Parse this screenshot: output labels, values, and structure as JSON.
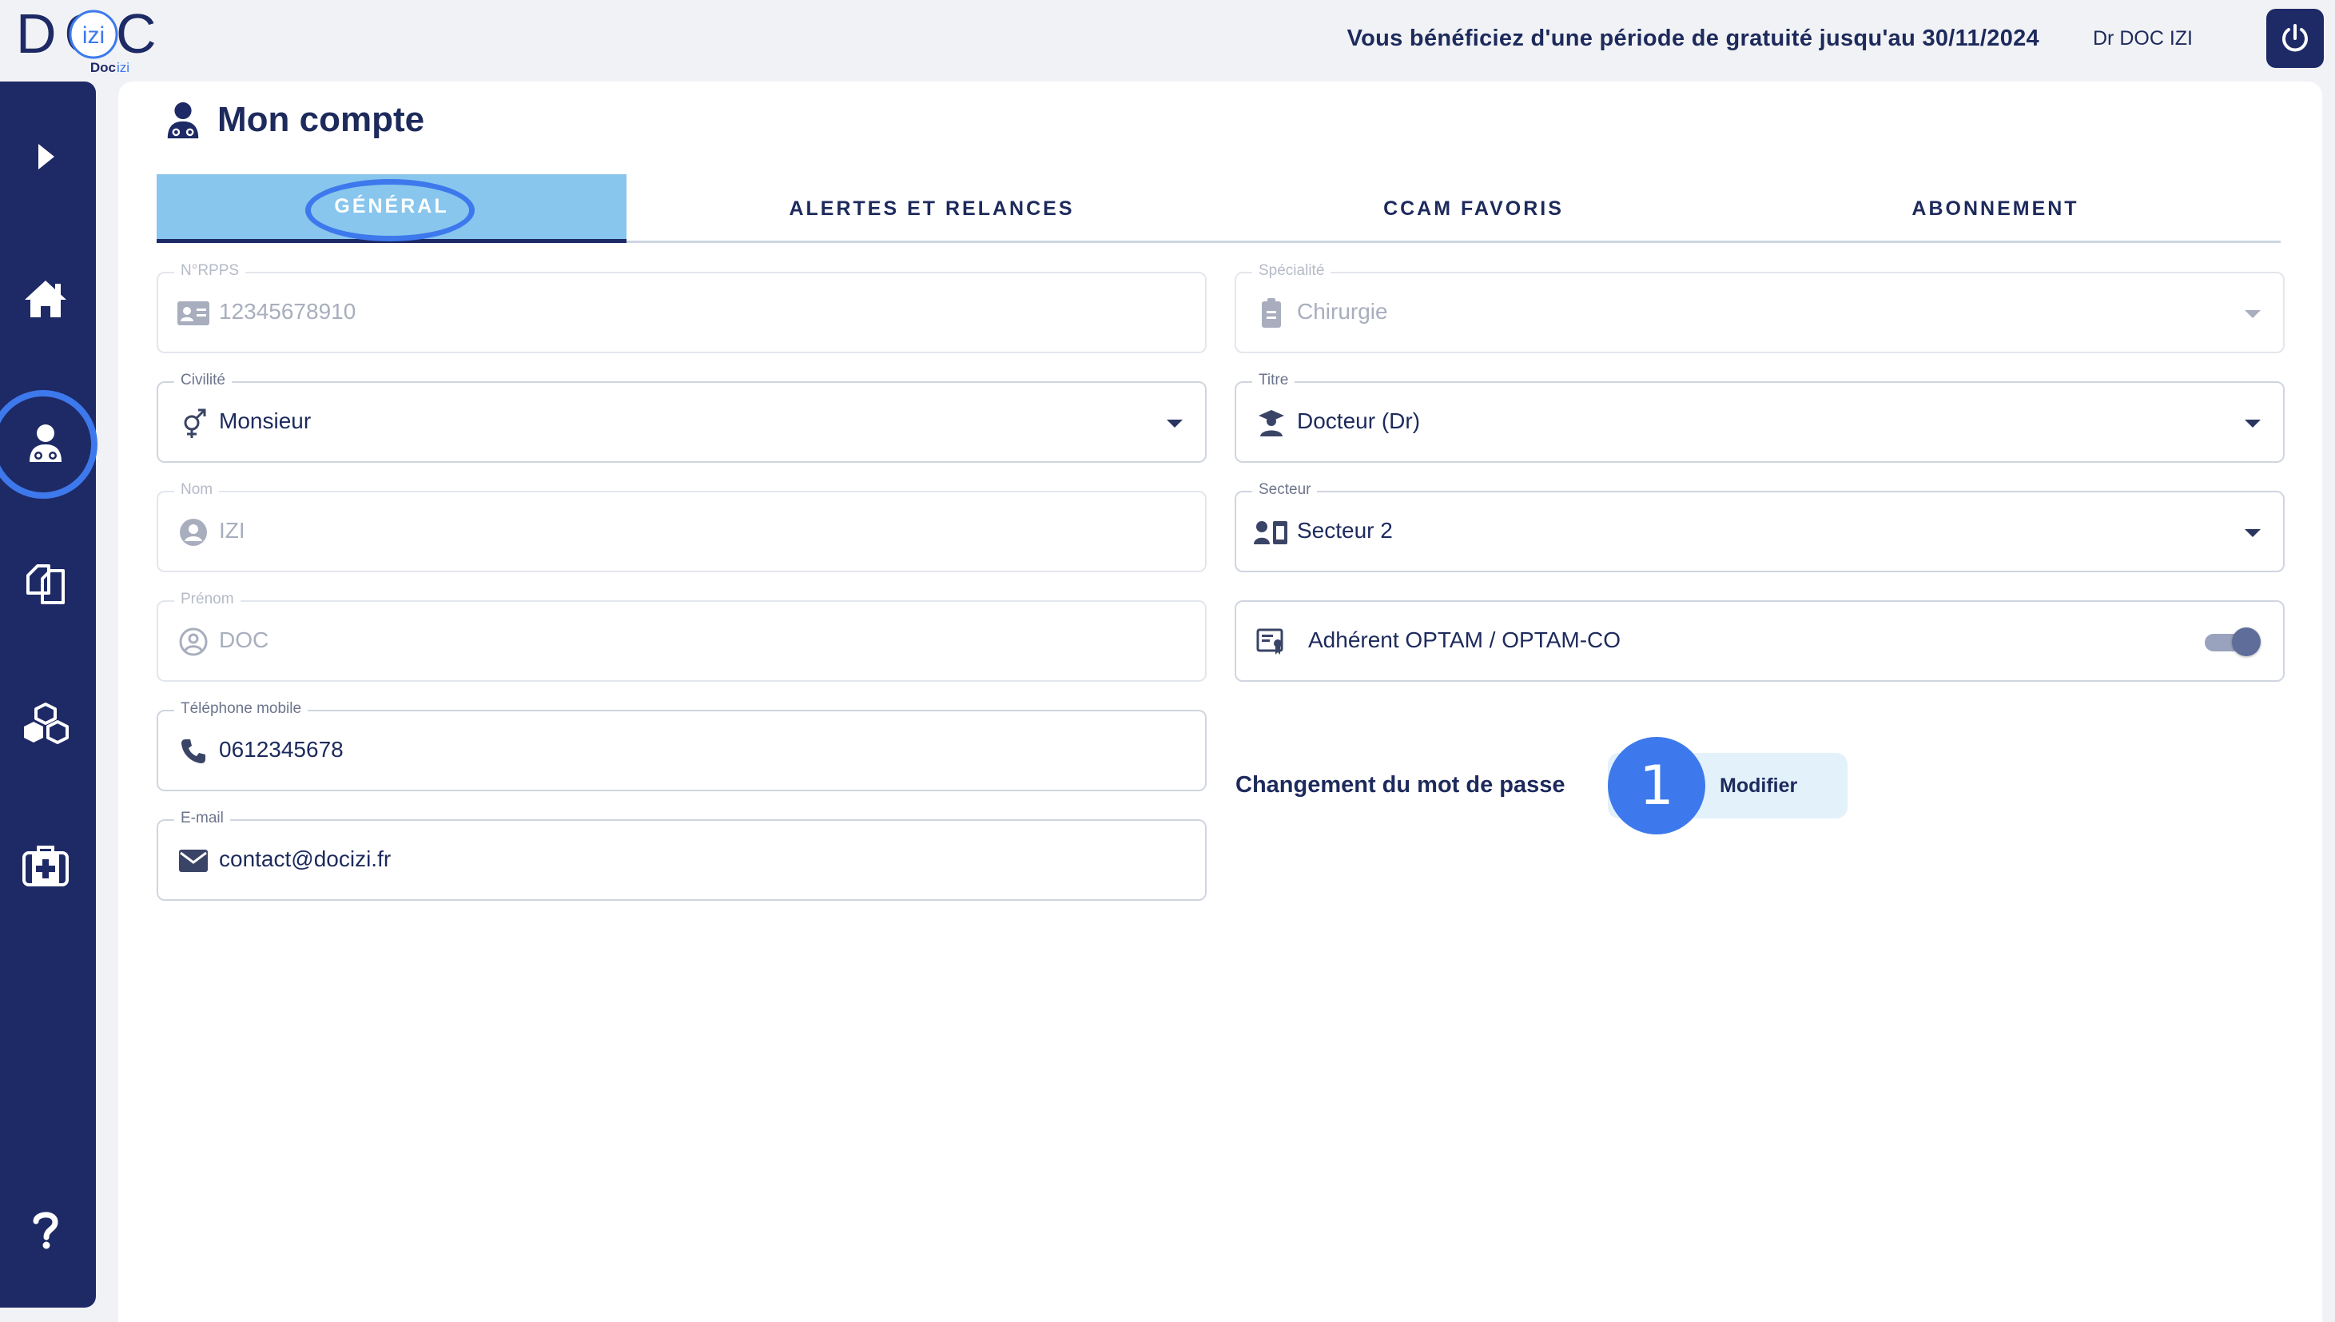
{
  "topbar": {
    "promo_text": "Vous bénéficiez d'une période de gratuité jusqu'au 30/11/2024",
    "user_name": "Dr DOC IZI",
    "logo_word": "DOC",
    "logo_inner": "izi",
    "logo_sub_1": "Doc",
    "logo_sub_2": "izi"
  },
  "sidebar": {
    "items": [
      {
        "icon": "expand-arrow-icon"
      },
      {
        "icon": "home-icon"
      },
      {
        "icon": "doctor-account-icon",
        "active": true
      },
      {
        "icon": "documents-icon"
      },
      {
        "icon": "boxes-icon"
      },
      {
        "icon": "medical-kit-icon"
      },
      {
        "icon": "help-icon"
      }
    ]
  },
  "page": {
    "title": "Mon compte"
  },
  "tabs": [
    {
      "label": "GÉNÉRAL",
      "active": true
    },
    {
      "label": "ALERTES ET RELANCES"
    },
    {
      "label": "CCAM FAVORIS"
    },
    {
      "label": "ABONNEMENT"
    }
  ],
  "form": {
    "rpps": {
      "label": "N°RPPS",
      "value": "12345678910"
    },
    "civilite": {
      "label": "Civilité",
      "value": "Monsieur"
    },
    "nom": {
      "label": "Nom",
      "value": "IZI"
    },
    "prenom": {
      "label": "Prénom",
      "value": "DOC"
    },
    "telephone": {
      "label": "Téléphone mobile",
      "value": "0612345678"
    },
    "email": {
      "label": "E-mail",
      "value": "contact@docizi.fr"
    },
    "specialite": {
      "label": "Spécialité",
      "value": "Chirurgie"
    },
    "titre": {
      "label": "Titre",
      "value": "Docteur (Dr)"
    },
    "secteur": {
      "label": "Secteur",
      "value": "Secteur 2"
    },
    "optam": {
      "label": "Adhérent OPTAM / OPTAM-CO",
      "enabled": true
    }
  },
  "password": {
    "label": "Changement du mot de passe",
    "button": "Modifier",
    "step_number": "1"
  },
  "colors": {
    "navy": "#1e2a66",
    "accent_blue": "#3d79ec",
    "tab_active_bg": "#88c6ed",
    "button_bg": "#e3f1fb"
  }
}
